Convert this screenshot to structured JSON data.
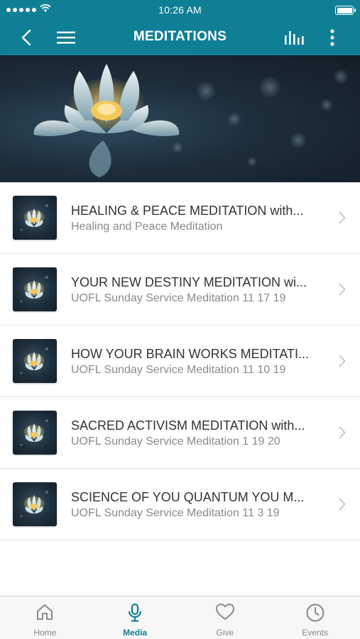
{
  "status_bar": {
    "time": "10:26 AM"
  },
  "nav": {
    "title": "MEDITATIONS"
  },
  "items": [
    {
      "title": "HEALING & PEACE MEDITATION with...",
      "subtitle": "Healing and Peace Meditation"
    },
    {
      "title": "YOUR NEW DESTINY MEDITATION wi...",
      "subtitle": "UOFL Sunday Service Meditation 11 17 19"
    },
    {
      "title": "HOW YOUR BRAIN  WORKS MEDITATI...",
      "subtitle": "UOFL Sunday Service Meditation 11 10 19"
    },
    {
      "title": "SACRED ACTIVISM MEDITATION with...",
      "subtitle": "UOFL Sunday Service Meditation 1 19 20"
    },
    {
      "title": "SCIENCE OF YOU QUANTUM YOU M...",
      "subtitle": "UOFL Sunday Service Meditation 11 3 19"
    }
  ],
  "tabs": [
    {
      "label": "Home",
      "icon": "home-icon"
    },
    {
      "label": "Media",
      "icon": "microphone-icon",
      "active": true
    },
    {
      "label": "Give",
      "icon": "heart-icon"
    },
    {
      "label": "Events",
      "icon": "clock-icon"
    }
  ],
  "colors": {
    "accent": "#0f7f96",
    "tab_inactive": "#8a8a8a"
  }
}
